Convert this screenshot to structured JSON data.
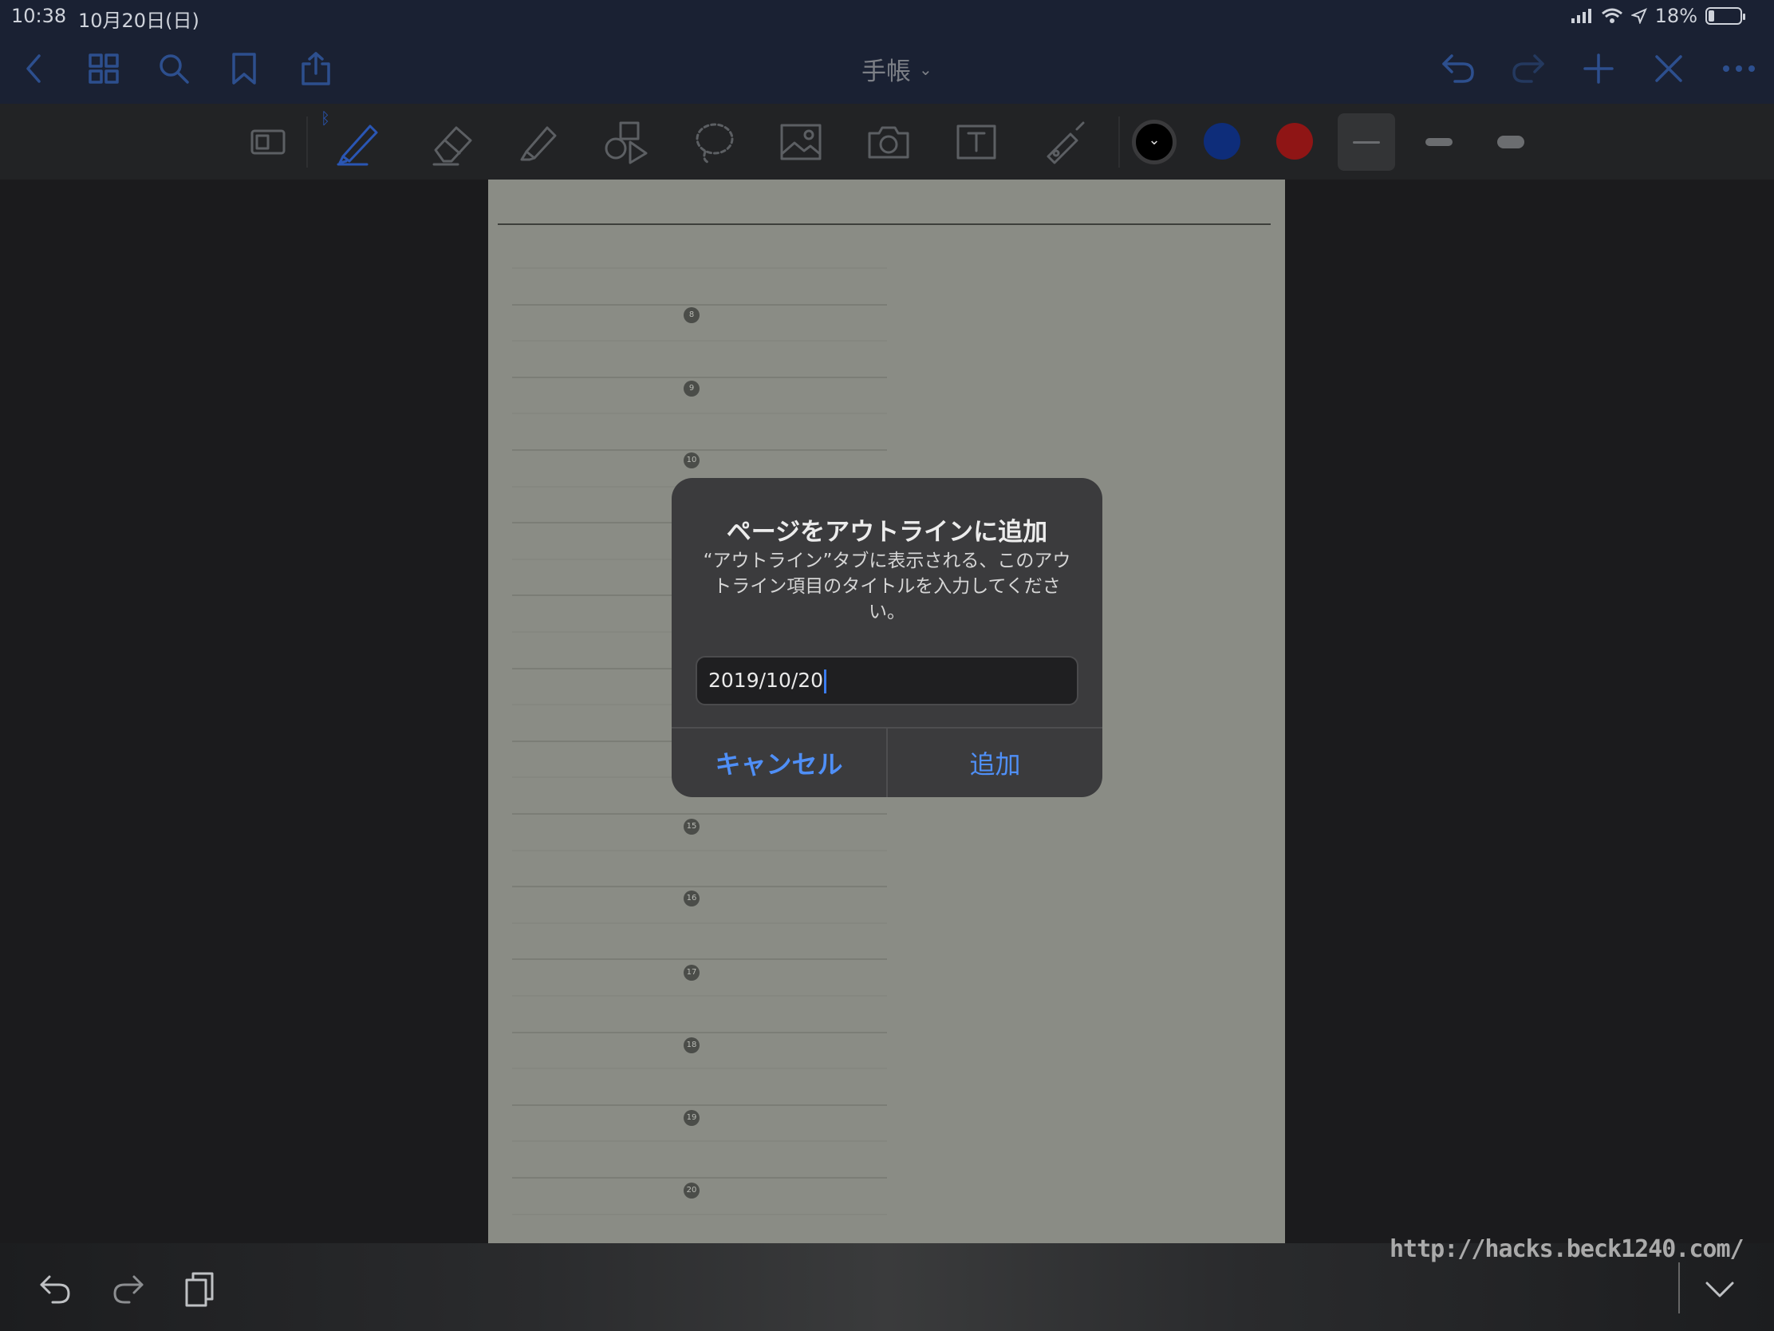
{
  "status_bar": {
    "time": "10:38",
    "date": "10月20日(日)",
    "battery": "18%",
    "battery_level": 0.18
  },
  "nav": {
    "title": "手帳",
    "icons": [
      "chevron-left-icon",
      "grid-icon",
      "search-icon",
      "bookmark-icon",
      "share-icon",
      "undo-icon",
      "redo-icon",
      "plus-icon",
      "close-icon",
      "more-icon"
    ]
  },
  "toolbar": {
    "colors": [
      "#000000",
      "#0e2d7a",
      "#8f1515"
    ],
    "tools": [
      "page-tool-icon",
      "pen-icon",
      "eraser-icon",
      "highlighter-icon",
      "shapes-icon",
      "lasso-icon",
      "image-icon",
      "camera-icon",
      "text-icon",
      "laser-pointer-icon"
    ]
  },
  "page": {
    "hours": [
      "8",
      "9",
      "10",
      "15",
      "16",
      "17",
      "18",
      "19",
      "20"
    ]
  },
  "dialog": {
    "title": "ページをアウトラインに追加",
    "message": "“アウトライン”タブに表示される、このアウトライン項目のタイトルを入力してください。",
    "input_value": "2019/10/20",
    "cancel_label": "キャンセル",
    "add_label": "追加"
  },
  "watermark": "http://hacks.beck1240.com/"
}
